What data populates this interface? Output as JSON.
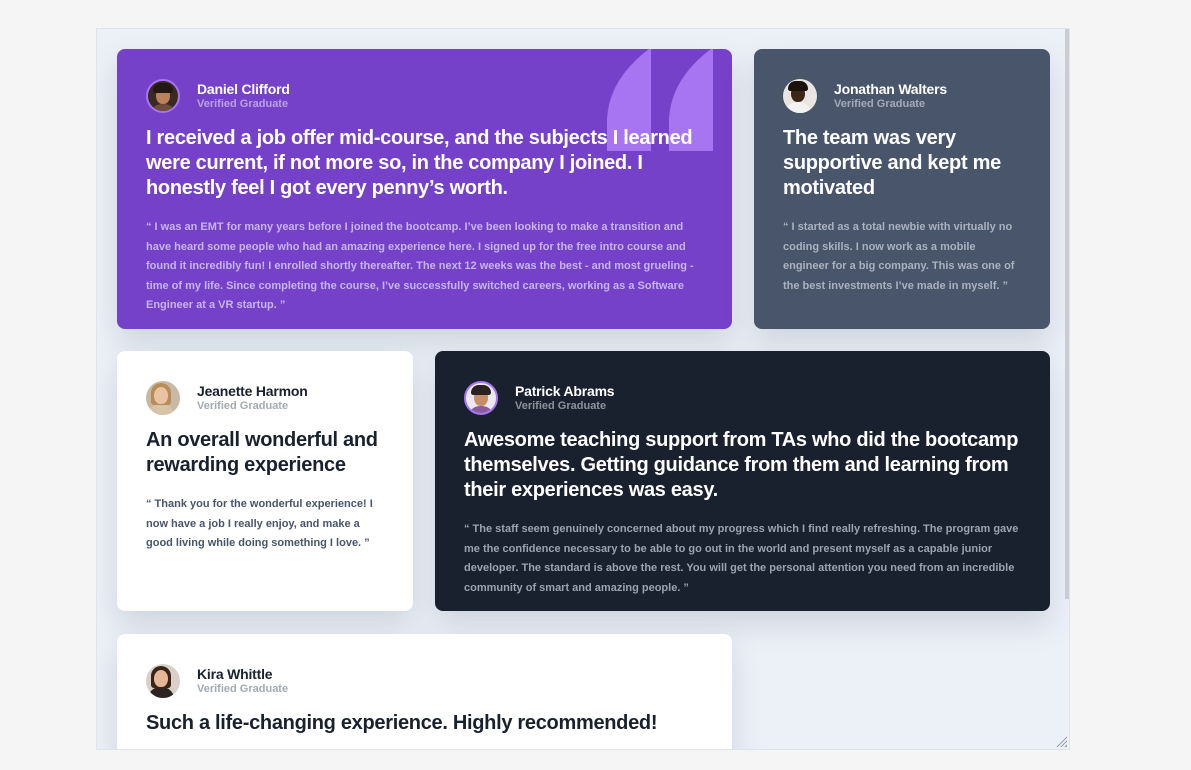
{
  "testimonials": [
    {
      "name": "Daniel Clifford",
      "status": "Verified Graduate",
      "headline": "I received a job offer mid-course, and the subjects I learned were current, if not more so, in the company I joined. I honestly feel I got every penny’s worth.",
      "quote": "“ I was an EMT for many years before I joined the bootcamp. I’ve been looking to make a transition and have heard some people who had an amazing experience here. I signed up for the free intro course and found it incredibly fun! I enrolled shortly thereafter. The next 12 weeks was the best - and most grueling - time of my life. Since completing the course, I’ve successfully switched careers, working as a Software Engineer at a VR startup. ”"
    },
    {
      "name": "Jonathan Walters",
      "status": "Verified Graduate",
      "headline": "The team was very supportive and kept me motivated",
      "quote": "“ I started as a total newbie with virtually no coding skills. I now work as a mobile engineer for a big company. This was one of the best investments I’ve made in myself. ”"
    },
    {
      "name": "Jeanette Harmon",
      "status": "Verified Graduate",
      "headline": "An overall wonderful and rewarding experience",
      "quote": "“ Thank you for the wonderful experience! I now have a job I really enjoy, and make a good living while doing something I love. ”"
    },
    {
      "name": "Patrick Abrams",
      "status": "Verified Graduate",
      "headline": "Awesome teaching support from TAs who did the bootcamp themselves. Getting guidance from them and learning from their experiences was easy.",
      "quote": "“ The staff seem genuinely concerned about my progress which I find really refreshing. The program gave me the confidence necessary to be able to go out in the world and present myself as a capable junior developer. The standard is above the rest. You will get the personal attention you need from an incredible community of smart and amazing people. ”"
    },
    {
      "name": "Kira Whittle",
      "status": "Verified Graduate",
      "headline": "Such a life-changing experience. Highly recommended!"
    }
  ],
  "colors": {
    "purple": "#7541c8",
    "grey_blue": "#48556a",
    "dark_blue": "#19212e",
    "white": "#ffffff",
    "background": "#ecf1f8",
    "light_purple": "#a775f1"
  },
  "icons": {
    "quotation_mark": "quotation-mark-icon",
    "resize_handle": "resize-grip-icon"
  }
}
